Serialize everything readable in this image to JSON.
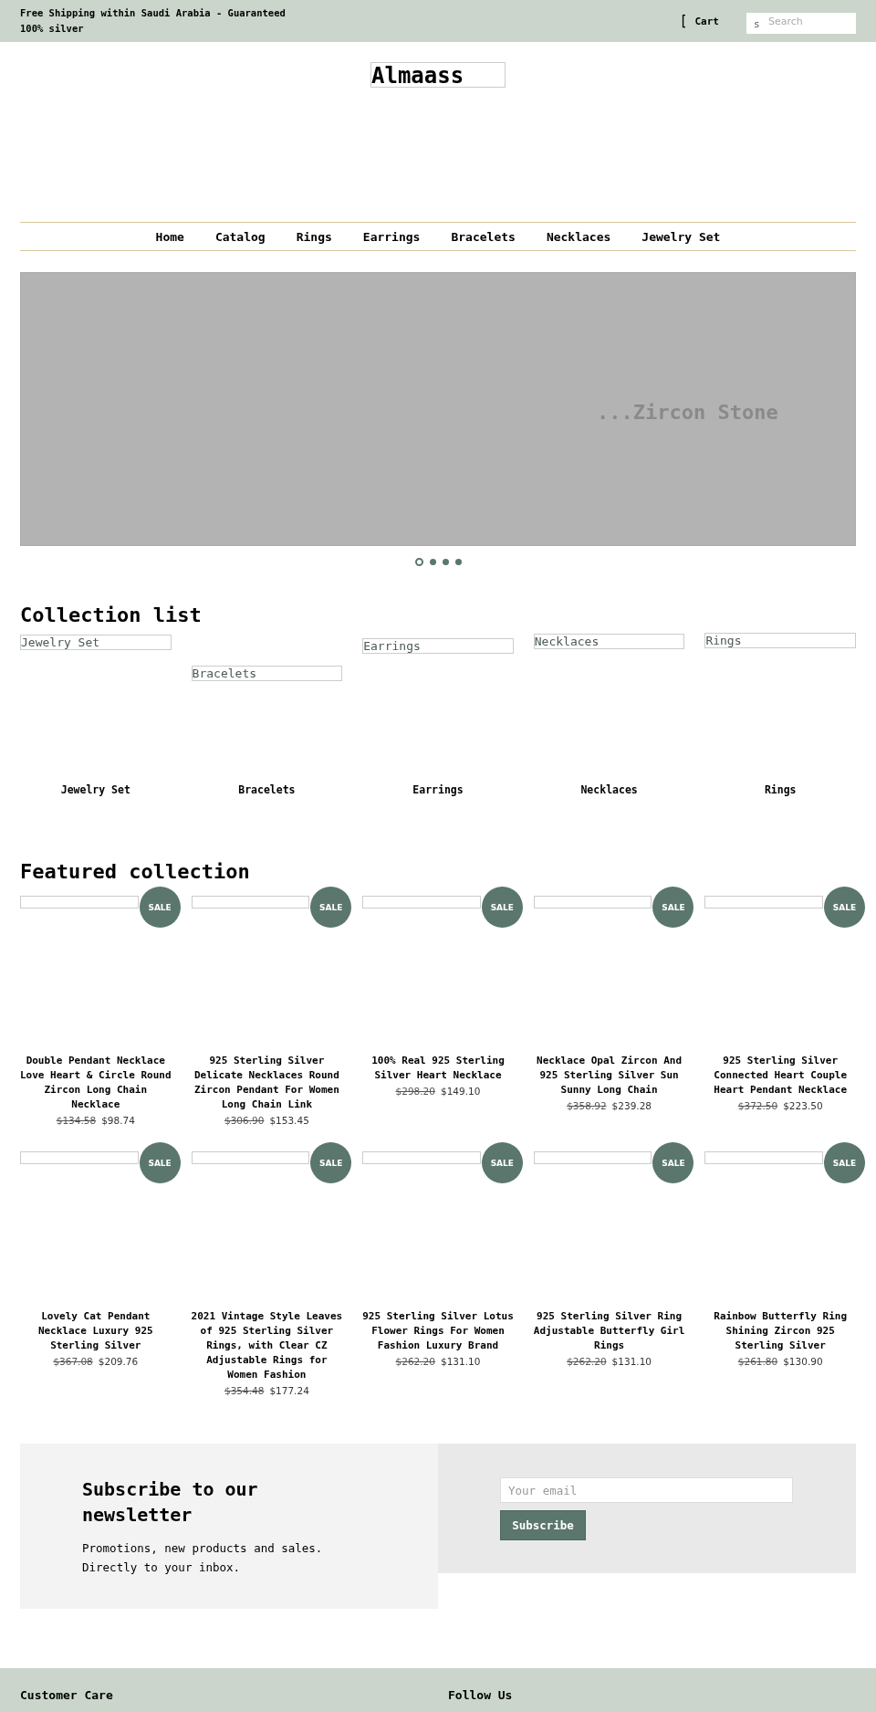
{
  "announcement": "Free Shipping within Saudi Arabia - Guaranteed 100% silver",
  "header": {
    "cart_glyph": "[",
    "cart": "Cart",
    "search_glyph": "s",
    "search_placeholder": "Search"
  },
  "logo": "Almaass",
  "nav": [
    "Home",
    "Catalog",
    "Rings",
    "Earrings",
    "Bracelets",
    "Necklaces",
    "Jewelry Set"
  ],
  "slideshow": {
    "caption": "...Zircon Stone",
    "dots": [
      {
        "selected": true
      },
      {
        "selected": false
      },
      {
        "selected": false
      },
      {
        "selected": false
      }
    ]
  },
  "collection_list": {
    "title": "Collection list",
    "items": [
      {
        "image_alt": "Jewelry Set",
        "label": "Jewelry Set"
      },
      {
        "image_alt": "Bracelets",
        "label": "Bracelets"
      },
      {
        "image_alt": "Earrings",
        "label": "Earrings"
      },
      {
        "image_alt": "Necklaces",
        "label": "Necklaces"
      },
      {
        "image_alt": "Rings",
        "label": "Rings"
      }
    ]
  },
  "featured": {
    "title": "Featured collection",
    "products": [
      {
        "badge": "SALE",
        "title": "Double Pendant Necklace Love Heart & Circle Round Zircon Long Chain Necklace",
        "compare_price": "$134.58",
        "price": "$98.74"
      },
      {
        "badge": "SALE",
        "title": "925 Sterling Silver Delicate Necklaces Round Zircon Pendant For Women Long Chain Link",
        "compare_price": "$306.90",
        "price": "$153.45"
      },
      {
        "badge": "SALE",
        "title": "100% Real 925 Sterling Silver Heart Necklace",
        "compare_price": "$298.20",
        "price": "$149.10"
      },
      {
        "badge": "SALE",
        "title": "Necklace Opal Zircon And 925 Sterling Silver Sun Sunny Long Chain",
        "compare_price": "$358.92",
        "price": "$239.28"
      },
      {
        "badge": "SALE",
        "title": "925 Sterling Silver Connected Heart Couple Heart Pendant Necklace",
        "compare_price": "$372.50",
        "price": "$223.50"
      },
      {
        "badge": "SALE",
        "title": "Lovely Cat Pendant Necklace Luxury 925 Sterling Silver",
        "compare_price": "$367.08",
        "price": "$209.76"
      },
      {
        "badge": "SALE",
        "title": "2021 Vintage Style Leaves of 925 Sterling Silver Rings, with Clear CZ Adjustable Rings for Women Fashion",
        "compare_price": "$354.48",
        "price": "$177.24"
      },
      {
        "badge": "SALE",
        "title": "925 Sterling Silver Lotus Flower Rings For Women Fashion Luxury Brand",
        "compare_price": "$262.20",
        "price": "$131.10"
      },
      {
        "badge": "SALE",
        "title": "925 Sterling Silver Ring Adjustable Butterfly Girl Rings",
        "compare_price": "$262.20",
        "price": "$131.10"
      },
      {
        "badge": "SALE",
        "title": "Rainbow Butterfly Ring Shining Zircon 925 Sterling Silver",
        "compare_price": "$261.80",
        "price": "$130.90"
      }
    ]
  },
  "newsletter": {
    "title": "Subscribe to our newsletter",
    "text": "Promotions, new products and sales. Directly to your inbox.",
    "email_placeholder": "Your email",
    "button": "Subscribe"
  },
  "footer": {
    "columns": [
      "Customer Care",
      "Follow Us"
    ]
  }
}
